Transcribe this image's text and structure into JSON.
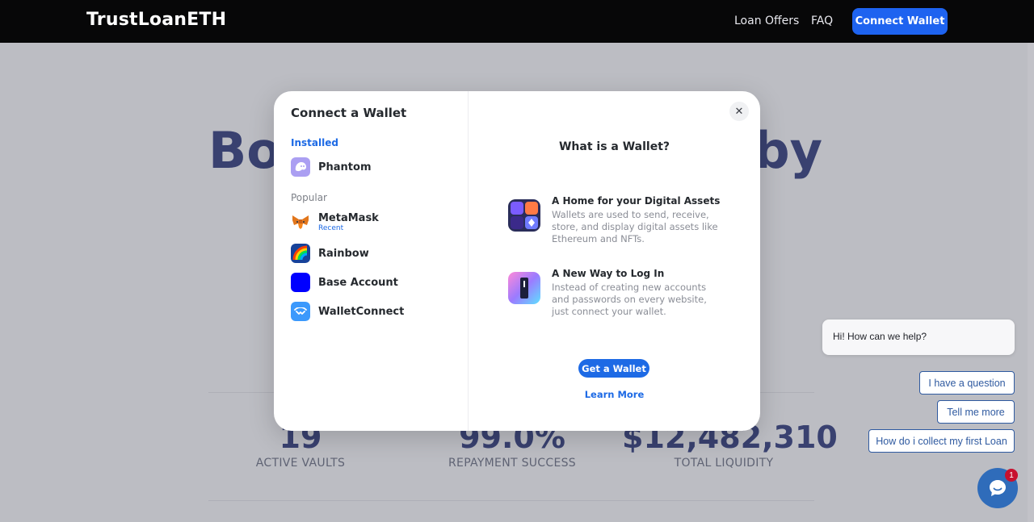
{
  "header": {
    "logo": "TrustLoanETH",
    "nav": [
      "Loan Offers",
      "FAQ"
    ],
    "connect_label": "Connect Wallet"
  },
  "page": {
    "hero_left": "Bor",
    "hero_right": "by",
    "stats": [
      {
        "value": "19",
        "label": "ACTIVE VAULTS"
      },
      {
        "value": "99.0%",
        "label": "REPAYMENT SUCCESS"
      },
      {
        "value": "$12,482,310",
        "label": "TOTAL LIQUIDITY"
      }
    ]
  },
  "modal": {
    "title": "Connect a Wallet",
    "installed_label": "Installed",
    "popular_label": "Popular",
    "installed": [
      {
        "name": "Phantom",
        "icon": "phantom-icon",
        "color": "#ab9ff2"
      }
    ],
    "popular": [
      {
        "name": "MetaMask",
        "sub": "Recent",
        "icon": "metamask-icon",
        "color": "#f6851b"
      },
      {
        "name": "Rainbow",
        "icon": "rainbow-icon",
        "color": "#174299"
      },
      {
        "name": "Base Account",
        "icon": "base-icon",
        "color": "#0000ff"
      },
      {
        "name": "WalletConnect",
        "icon": "walletconnect-icon",
        "color": "#3b99fc"
      }
    ],
    "right_title": "What is a Wallet?",
    "features": [
      {
        "head": "A Home for your Digital Assets",
        "desc": "Wallets are used to send, receive, store, and display digital assets like Ethereum and NFTs."
      },
      {
        "head": "A New Way to Log In",
        "desc": "Instead of creating new accounts and passwords on every website, just connect your wallet."
      }
    ],
    "get_wallet": "Get a Wallet",
    "learn_more": "Learn More",
    "close_glyph": "✕"
  },
  "chat": {
    "greeting": "Hi! How can we help?",
    "options": [
      "I have a question",
      "Tell me more",
      "How do i collect my first Loan"
    ],
    "badge": "1"
  },
  "colors": {
    "accent": "#1d6ae5",
    "navy": "#13206a"
  }
}
